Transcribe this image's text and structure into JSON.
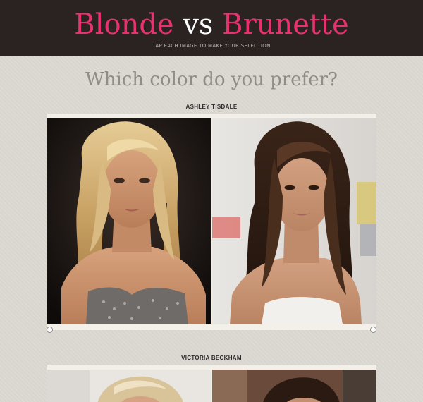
{
  "header": {
    "title_blonde": "Blonde",
    "title_vs": "vs",
    "title_brunette": "Brunette",
    "tagline": "TAP EACH IMAGE TO MAKE YOUR SELECTION"
  },
  "question": "Which color do you prefer?",
  "comparisons": [
    {
      "name": "ASHLEY TISDALE",
      "left_photo_icon": "blonde-photo-icon",
      "right_photo_icon": "brunette-photo-icon"
    },
    {
      "name": "VICTORIA BECKHAM",
      "left_photo_icon": "blonde-photo-icon",
      "right_photo_icon": "brunette-photo-icon"
    }
  ],
  "colors": {
    "header_bg": "#2a2322",
    "title_accent": "#e8326f",
    "question_text": "#908d89",
    "page_bg": "#d9d6d0"
  }
}
